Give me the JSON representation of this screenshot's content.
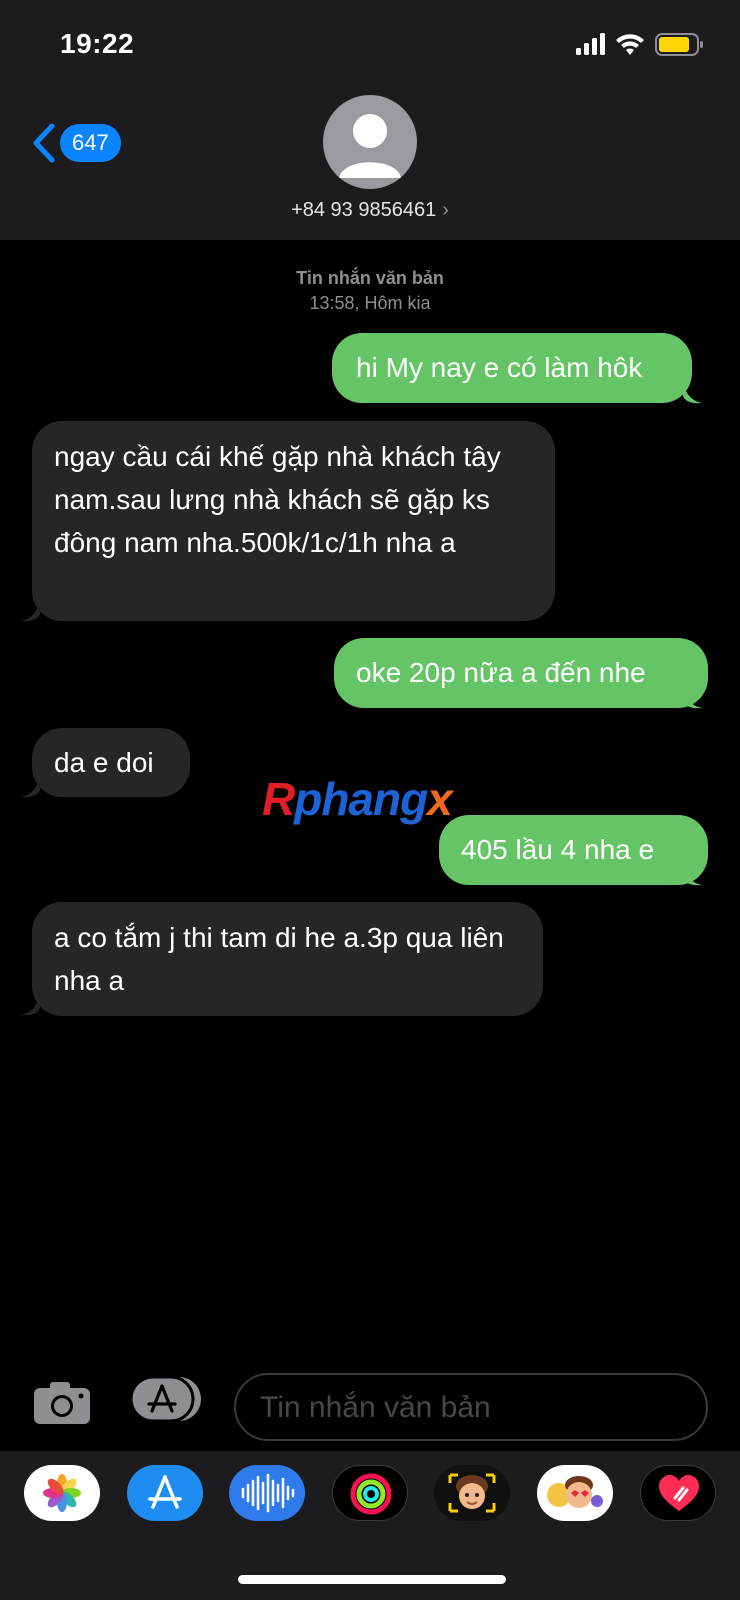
{
  "status_bar": {
    "time": "19:22"
  },
  "nav": {
    "back_count": "647",
    "contact": "+84 93 9856461"
  },
  "timestamp": {
    "label": "Tin nhắn văn bản",
    "time": "13:58, Hôm kia"
  },
  "messages": [
    {
      "dir": "out",
      "text": "hi My nay e có làm hôk"
    },
    {
      "dir": "in",
      "text": "ngay cầu cái khế gặp nhà khách tây nam.sau lưng nhà khách sẽ gặp ks đông nam nha.500k/1c/1h nha a"
    },
    {
      "dir": "out",
      "text": "oke 20p nữa a đến nhe"
    },
    {
      "dir": "in",
      "text": "da e doi"
    },
    {
      "dir": "out",
      "text": "405 lầu 4 nha e"
    },
    {
      "dir": "in",
      "text": "a co tắm j thi tam di he a.3p qua liên nha a"
    }
  ],
  "watermark": {
    "r": "R",
    "main": "phang",
    "x": "x"
  },
  "composer": {
    "placeholder": "Tin nhắn văn bản"
  },
  "app_drawer": [
    "photos-icon",
    "app-store-icon",
    "audio-message-icon",
    "fitness-rings-icon",
    "memoji-icon",
    "memoji-stickers-icon",
    "digital-touch-icon"
  ],
  "colors": {
    "sent": "#65c466",
    "received": "#262628",
    "accent": "#0a84ff",
    "background": "#000000"
  }
}
